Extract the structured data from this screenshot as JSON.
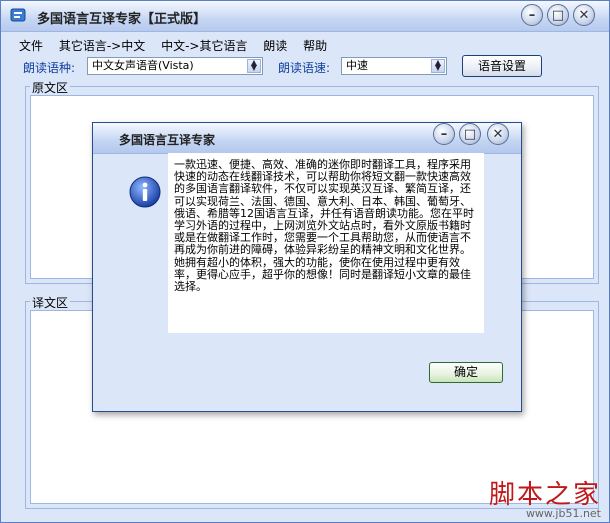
{
  "window": {
    "title": "多国语言互译专家【正式版】",
    "controls": [
      "minimize-icon",
      "maximize-icon",
      "close-icon"
    ]
  },
  "menu": [
    "文件",
    "其它语言->中文",
    "中文->其它语言",
    "朗读",
    "帮助"
  ],
  "toolbar": {
    "lang_label": "朗读语种:",
    "lang_value": "中文女声语音(Vista)",
    "speed_label": "朗读语速:",
    "speed_value": "中速",
    "settings_button": "语音设置"
  },
  "panels": {
    "source_label": "原文区",
    "target_label": "译文区"
  },
  "dialog": {
    "title": "多国语言互译专家",
    "icon": "info-icon",
    "message": "一款迅速、便捷、高效、准确的迷你即时翻译工具，程序采用快速的动态在线翻译技术，可以帮助你将短文翻一款快速高效的多国语言翻译软件，不仅可以实现英汉互译、繁简互译，还可以实现荷兰、法国、德国、意大利、日本、韩国、葡萄牙、俄语、希腊等12国语言互译，并任有语音朗读功能。您在平时学习外语的过程中，上网浏览外文站点时，看外文原版书籍时或是在做翻译工作时，您需要一个工具帮助您，从而使语言不再成为你前进的障碍，体验异彩纷呈的精神文明和文化世界。她拥有超小的体积，强大的功能，使你在使用过程中更有效率，更得心应手，超乎你的想像！同时是翻译短小文章的最佳选择。",
    "ok_button": "确定"
  },
  "watermark": {
    "text": "脚本之家",
    "url": "www.jb51.net"
  }
}
